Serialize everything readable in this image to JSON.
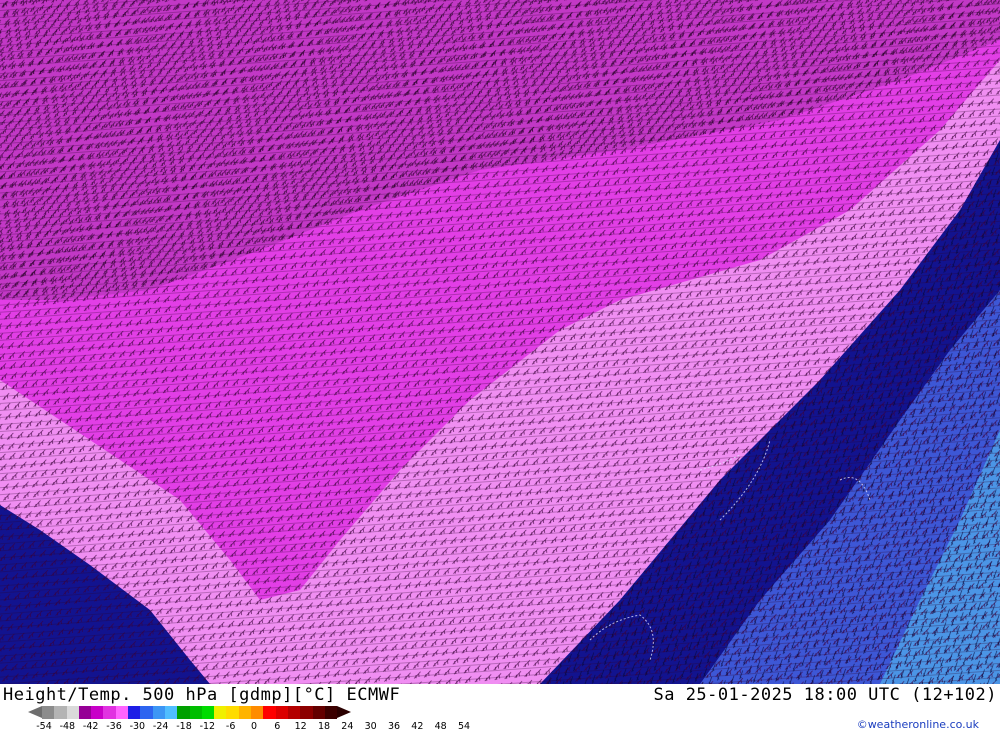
{
  "header": {
    "title_left": "Height/Temp. 500 hPa [gdmp][°C] ECMWF",
    "title_right": "Sa 25-01-2025 18:00 UTC (12+102)"
  },
  "legend": {
    "ticks": [
      "-54",
      "-48",
      "-42",
      "-36",
      "-30",
      "-24",
      "-18",
      "-12",
      "-6",
      "0",
      "6",
      "12",
      "18",
      "24",
      "30",
      "36",
      "42",
      "48",
      "54"
    ],
    "colors": [
      "#8c8c8c",
      "#b4b4b4",
      "#dadada",
      "#960096",
      "#c800c8",
      "#e132e1",
      "#ff64ff",
      "#1e1ee6",
      "#2d64f0",
      "#3c96f5",
      "#50beff",
      "#00a000",
      "#00be00",
      "#00dc00",
      "#f0f000",
      "#ffdc00",
      "#ffb400",
      "#ff8c00",
      "#ff0000",
      "#dc0000",
      "#b40000",
      "#8c0000",
      "#640000",
      "#3c0000"
    ]
  },
  "credit": "©weatheronline.co.uk",
  "map_colors": {
    "deep_magenta": "#c238c6",
    "magenta": "#e23ee6",
    "pink": "#f08ef2",
    "navy": "#12138f",
    "blue": "#3d57d6",
    "sky": "#4b95e6"
  }
}
